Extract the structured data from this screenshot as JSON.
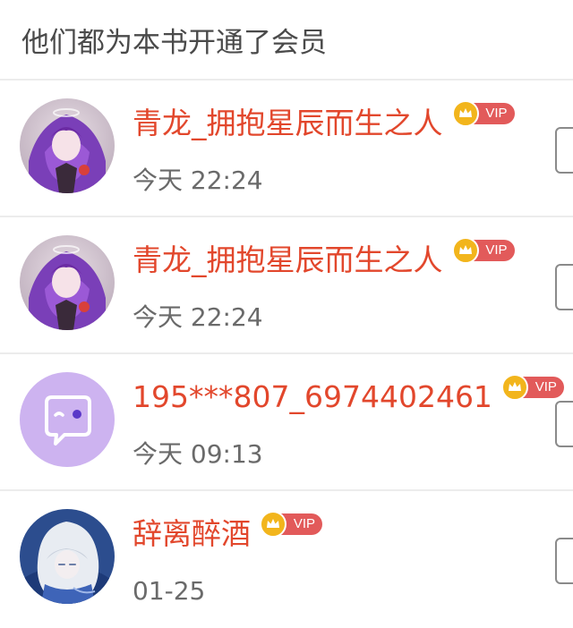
{
  "header": {
    "title": "他们都为本书开通了会员"
  },
  "colors": {
    "name": "#e2472c",
    "vip_pill": "#e25a5a",
    "coin": "#f2b51c",
    "divider": "#ececec"
  },
  "members": [
    {
      "name": "青龙_拥抱星辰而生之人",
      "vip_label": "VIP",
      "time": "今天 22:24",
      "avatar_icon": "anime-girl-purple-avatar"
    },
    {
      "name": "青龙_拥抱星辰而生之人",
      "vip_label": "VIP",
      "time": "今天 22:24",
      "avatar_icon": "anime-girl-purple-avatar"
    },
    {
      "name": "195***807_6974402461",
      "vip_label": "VIP",
      "time": "今天 09:13",
      "avatar_icon": "chat-bubble-default-avatar"
    },
    {
      "name": "辞离醉酒",
      "vip_label": "VIP",
      "time": "01-25",
      "avatar_icon": "silver-hair-character-avatar"
    }
  ]
}
